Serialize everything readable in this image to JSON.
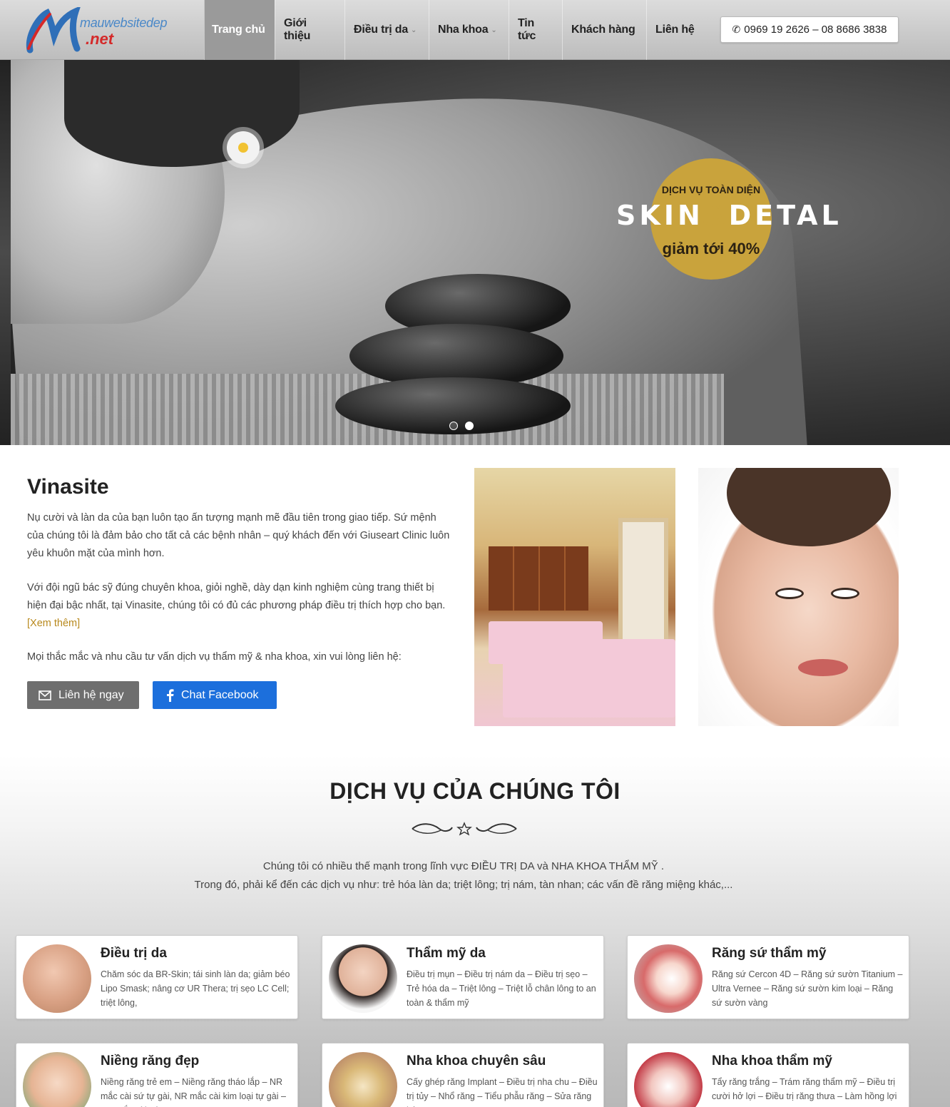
{
  "header": {
    "logo": {
      "site_text": "mauwebsitedep",
      "tld_text": ".net"
    },
    "nav": [
      {
        "label": "Trang chủ",
        "active": true,
        "has_dropdown": false
      },
      {
        "label": "Giới thiệu",
        "active": false,
        "has_dropdown": false
      },
      {
        "label": "Điều trị da",
        "active": false,
        "has_dropdown": true
      },
      {
        "label": "Nha khoa",
        "active": false,
        "has_dropdown": true
      },
      {
        "label": "Tin tức",
        "active": false,
        "has_dropdown": false
      },
      {
        "label": "Khách hàng",
        "active": false,
        "has_dropdown": false
      },
      {
        "label": "Liên hệ",
        "active": false,
        "has_dropdown": false
      }
    ],
    "phone": "0969 19 2626 – 08 8686 3838",
    "phone_icon": "phone-icon"
  },
  "hero": {
    "badge_line1": "DỊCH VỤ TOÀN DIỆN",
    "badge_skin": "SKIN",
    "badge_amp": "&",
    "badge_detal": "DETAL",
    "badge_line3": "giảm tới 40%",
    "slides_total": 2,
    "active_slide": 2
  },
  "intro": {
    "title": "Vinasite",
    "p1": "Nụ cười và làn da của bạn luôn tạo ấn tượng mạnh mẽ đầu tiên trong giao tiếp. Sứ mệnh của chúng tôi là đảm bảo cho tất cả các bệnh nhân – quý khách đến với Giuseart Clinic luôn yêu khuôn mặt của mình hơn.",
    "p2": "Với đội ngũ bác sỹ đúng chuyên khoa, giỏi nghề, dày dạn kinh nghiệm cùng trang thiết bị hiện đại bậc nhất, tại Vinasite, chúng tôi có đủ các phương pháp điều trị thích hợp cho bạn.",
    "more_link": "[Xem thêm]",
    "p3": "Mọi thắc mắc và nhu cầu tư vấn dịch vụ thẩm mỹ & nha khoa, xin vui lòng liên hệ:",
    "btn_contact": "Liên hệ ngay",
    "btn_contact_icon": "mail-icon",
    "btn_facebook": "Chat Facebook",
    "btn_facebook_icon": "facebook-icon"
  },
  "services": {
    "title": "DỊCH VỤ CỦA CHÚNG TÔI",
    "desc1": "Chúng tôi có nhiều thế mạnh trong lĩnh vực  ĐIỀU TRỊ DA  và  NHA KHOA THẨM MỸ .",
    "desc2": "Trong đó, phải kể đến các dịch vụ như: trẻ hóa làn da; triệt lông; trị nám, tàn nhan; các vấn đề răng miệng khác,...",
    "cards": [
      {
        "title": "Điều trị da",
        "desc": "Chăm sóc da BR-Skin; tái sinh làn da; giảm béo Lipo Smask; nâng cơ UR Thera; trị sẹo LC Cell; triệt lông,"
      },
      {
        "title": "Thẩm mỹ da",
        "desc": "Điều trị mụn – Điều trị nám da – Điều trị sẹo – Trẻ hóa da – Triệt lông – Triệt lỗ chân lông to an toàn & thẩm mỹ"
      },
      {
        "title": "Răng sứ thẩm mỹ",
        "desc": "Răng sứ Cercon 4D – Răng sứ sườn Titanium – Ultra Vernee – Răng sứ sườn kim loại – Răng sứ sườn vàng"
      },
      {
        "title": "Niềng răng đẹp",
        "desc": "Niềng răng trẻ em – Niềng răng tháo lắp – NR mắc cài sứ tự gài, NR mắc cài kim loại tự gài – NR mắc cài sứ"
      },
      {
        "title": "Nha khoa chuyên sâu",
        "desc": "Cấy ghép răng Implant – Điều trị nha chu – Điều trị tủy – Nhổ răng – Tiểu phẫu răng – Sửa răng hô"
      },
      {
        "title": "Nha khoa thẩm mỹ",
        "desc": "Tẩy răng trắng – Trám răng thẩm mỹ – Điều trị cười hở lợi – Điều trị răng thưa – Làm hồng lợi"
      }
    ]
  },
  "colors": {
    "nav_active_bg": "#9a9a9a",
    "badge_gold": "#c9a33c",
    "facebook_blue": "#1c6fdc",
    "contact_gray": "#6e6e6e",
    "more_link": "#b8891d"
  }
}
